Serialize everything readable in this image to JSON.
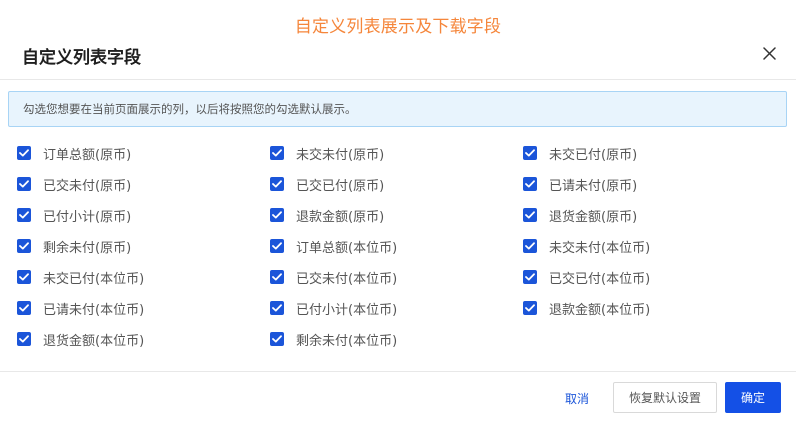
{
  "caption": "自定义列表展示及下载字段",
  "dialog": {
    "title": "自定义列表字段",
    "close_label": "X",
    "notice": "勾选您想要在当前页面展示的列，以后将按照您的勾选默认展示。"
  },
  "columns": [
    {
      "checked": true,
      "label": "订单总额(原币)"
    },
    {
      "checked": true,
      "label": "未交未付(原币)"
    },
    {
      "checked": true,
      "label": "未交已付(原币)"
    },
    {
      "checked": true,
      "label": "已交未付(原币)"
    },
    {
      "checked": true,
      "label": "已交已付(原币)"
    },
    {
      "checked": true,
      "label": "已请未付(原币)"
    },
    {
      "checked": true,
      "label": "已付小计(原币)"
    },
    {
      "checked": true,
      "label": "退款金额(原币)"
    },
    {
      "checked": true,
      "label": "退货金额(原币)"
    },
    {
      "checked": true,
      "label": "剩余未付(原币)"
    },
    {
      "checked": true,
      "label": "订单总额(本位币)"
    },
    {
      "checked": true,
      "label": "未交未付(本位币)"
    },
    {
      "checked": true,
      "label": "未交已付(本位币)"
    },
    {
      "checked": true,
      "label": "已交未付(本位币)"
    },
    {
      "checked": true,
      "label": "已交已付(本位币)"
    },
    {
      "checked": true,
      "label": "已请未付(本位币)"
    },
    {
      "checked": true,
      "label": "已付小计(本位币)"
    },
    {
      "checked": true,
      "label": "退款金额(本位币)"
    },
    {
      "checked": true,
      "label": "退货金额(本位币)"
    },
    {
      "checked": true,
      "label": "剩余未付(本位币)"
    }
  ],
  "footer": {
    "cancel_label": "取消",
    "reset_label": "恢复默认设置",
    "confirm_label": "确定"
  },
  "colors": {
    "caption": "#f5863b",
    "checkbox": "#1b55d9",
    "primary_button": "#1450e6",
    "notice_bg": "#e8f4fd",
    "notice_border": "#a8d4f5"
  }
}
